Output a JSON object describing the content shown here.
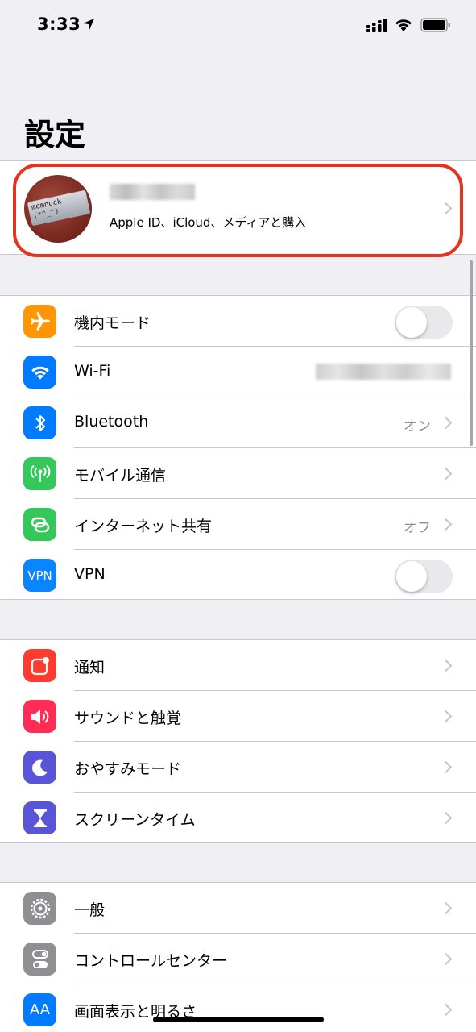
{
  "status_bar": {
    "time": "3:33",
    "icons": [
      "location-arrow-icon",
      "cellular-signal-icon",
      "wifi-icon",
      "battery-icon"
    ]
  },
  "title": "設定",
  "profile": {
    "subtitle": "Apple ID、iCloud、メディアと購入",
    "avatar_text": [
      "memnock",
      "(*^_^)"
    ]
  },
  "groups": [
    {
      "rows": [
        {
          "label": "機内モード",
          "icon": "airplane-icon",
          "color": "#ff9500",
          "control": "toggle",
          "toggle_on": false
        },
        {
          "label": "Wi-Fi",
          "icon": "wifi-icon",
          "color": "#007aff",
          "control": "blurred"
        },
        {
          "label": "Bluetooth",
          "icon": "bluetooth-icon",
          "color": "#007aff",
          "value": "オン"
        },
        {
          "label": "モバイル通信",
          "icon": "cellular-antenna-icon",
          "color": "#34c759"
        },
        {
          "label": "インターネット共有",
          "icon": "hotspot-icon",
          "color": "#34c759",
          "value": "オフ"
        },
        {
          "label": "VPN",
          "icon": "vpn-icon",
          "icon_text": "VPN",
          "color": "#0a84ff",
          "control": "toggle",
          "toggle_on": false
        }
      ]
    },
    {
      "rows": [
        {
          "label": "通知",
          "icon": "notifications-icon",
          "color": "#ff3b30"
        },
        {
          "label": "サウンドと触覚",
          "icon": "speaker-icon",
          "color": "#ff2d55"
        },
        {
          "label": "おやすみモード",
          "icon": "moon-icon",
          "color": "#5856d6"
        },
        {
          "label": "スクリーンタイム",
          "icon": "hourglass-icon",
          "color": "#5856d6"
        }
      ]
    },
    {
      "rows": [
        {
          "label": "一般",
          "icon": "gear-icon",
          "color": "#8e8e93"
        },
        {
          "label": "コントロールセンター",
          "icon": "switches-icon",
          "color": "#8e8e93"
        },
        {
          "label": "画面表示と明るさ",
          "icon": "text-size-icon",
          "icon_text": "AA",
          "color": "#007aff"
        }
      ]
    }
  ]
}
